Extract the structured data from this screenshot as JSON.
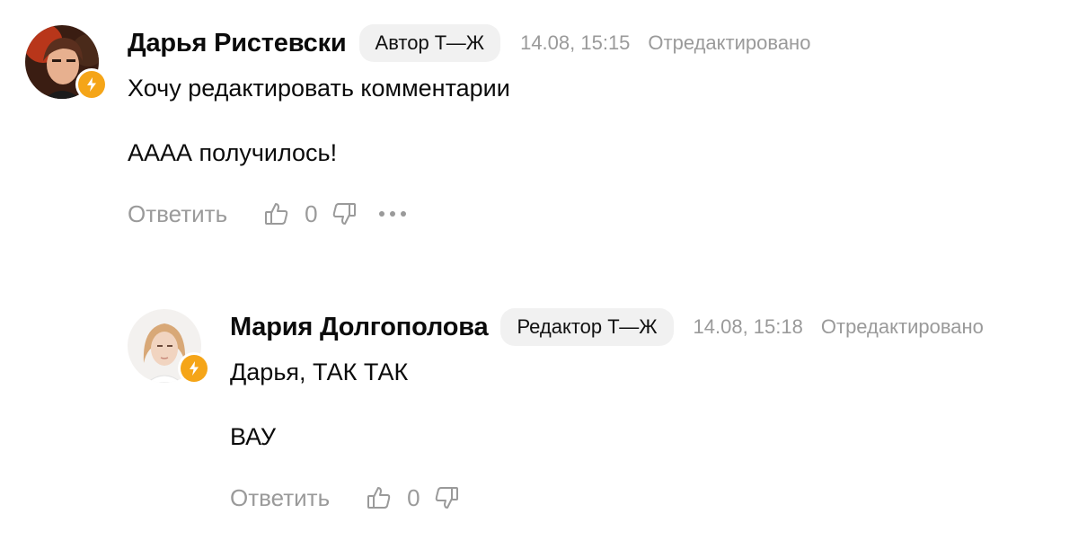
{
  "comments": [
    {
      "author": "Дарья Ристевски",
      "role": "Автор Т—Ж",
      "time": "14.08, 15:15",
      "edited": "Отредактировано",
      "paragraphs": [
        "Хочу редактировать комментарии",
        "АААА получилось!"
      ],
      "reply_label": "Ответить",
      "likes": "0",
      "avatar_icon": "user-photo",
      "badge_icon": "lightning-icon"
    },
    {
      "author": "Мария Долгополова",
      "role": "Редактор Т—Ж",
      "time": "14.08, 15:18",
      "edited": "Отредактировано",
      "paragraphs": [
        "Дарья, ТАК ТАК",
        "ВАУ"
      ],
      "reply_label": "Ответить",
      "likes": "0",
      "avatar_icon": "user-photo",
      "badge_icon": "lightning-icon"
    }
  ],
  "colors": {
    "badge": "#f5a518",
    "muted": "#9a9a9a",
    "pill": "#f1f1f1"
  }
}
